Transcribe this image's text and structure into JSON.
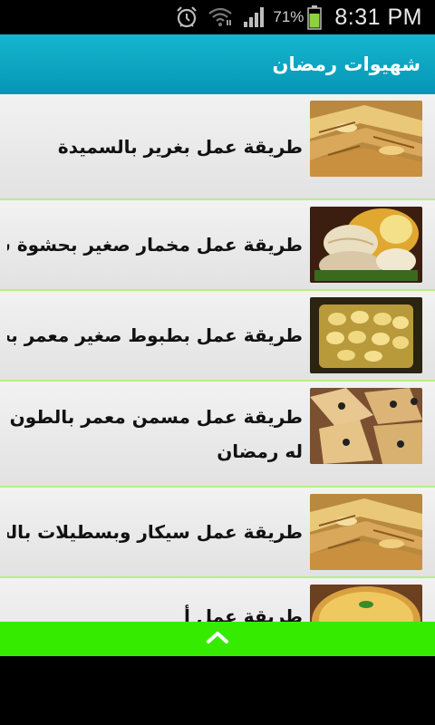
{
  "status_bar": {
    "battery_percent": "71%",
    "time": "8:31 PM",
    "icons": [
      "alarm-icon",
      "wifi-icon",
      "signal-icon",
      "battery-icon"
    ]
  },
  "header": {
    "title": "شهيوات رمضان"
  },
  "items": [
    {
      "label": "طريقة عمل بغرير بالسميدة",
      "thumbnail": "food-photo-rolls"
    },
    {
      "label": "طريقة عمل مخمار صغير بحشوة س",
      "thumbnail": "food-photo-bread"
    },
    {
      "label": "طريقة عمل بطبوط صغير معمر بحش",
      "thumbnail": "food-photo-tray"
    },
    {
      "label": "طريقة عمل مسمن معمر بالطون له رمضان",
      "thumbnail": "food-photo-pastry"
    },
    {
      "label": "طريقة عمل سيكار وبسطيلات بالحو",
      "thumbnail": "food-photo-rolls"
    },
    {
      "label": "طريقة عمل أ",
      "thumbnail": "food-photo-pie"
    }
  ],
  "bottom_bar": {
    "icon": "chevron-up-icon",
    "color": "#35ec00"
  },
  "colors": {
    "header": "#0aa6c2",
    "divider": "#b8ee86"
  }
}
